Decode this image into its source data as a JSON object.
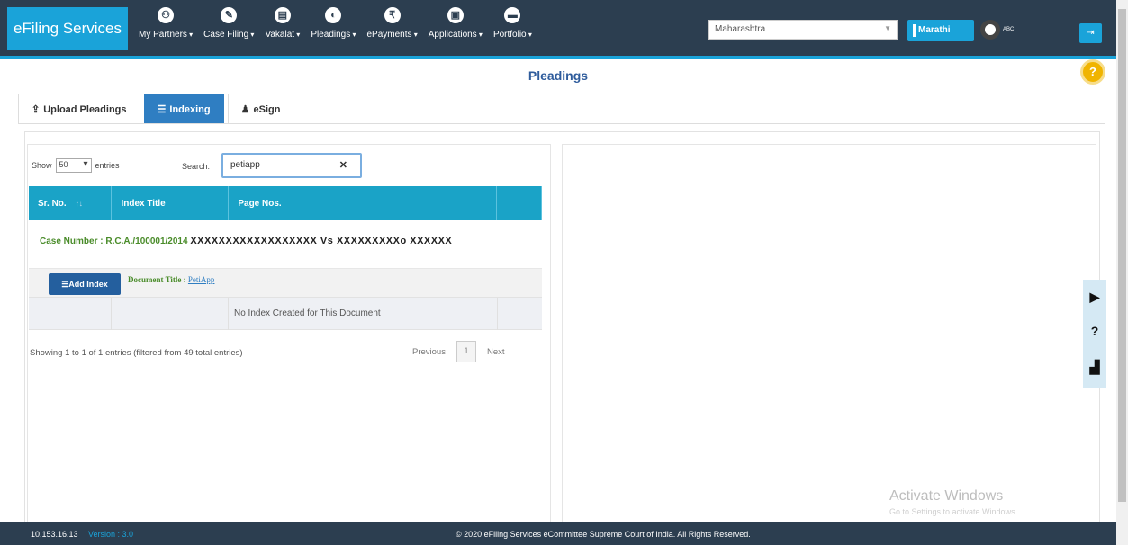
{
  "header": {
    "brand": "eFiling Services",
    "nav": [
      {
        "label": "My Partners",
        "icon": "partners-icon",
        "glyph": "⚇"
      },
      {
        "label": "Case Filing",
        "icon": "pencil-icon",
        "glyph": "✎"
      },
      {
        "label": "Vakalat",
        "icon": "document-icon",
        "glyph": "▤"
      },
      {
        "label": "Pleadings",
        "icon": "pleadings-icon",
        "glyph": "◐"
      },
      {
        "label": "ePayments",
        "icon": "rupee-icon",
        "glyph": "₹"
      },
      {
        "label": "Applications",
        "icon": "application-icon",
        "glyph": "▣"
      },
      {
        "label": "Portfolio",
        "icon": "briefcase-icon",
        "glyph": "▬"
      }
    ],
    "state_select": "Maharashtra",
    "language_button": "Marathi",
    "font_toggle_label": "ABC"
  },
  "page_title": "Pleadings",
  "tabs": [
    {
      "label": "Upload Pleadings",
      "icon": "upload-icon",
      "glyph": "⇪",
      "active": false
    },
    {
      "label": "Indexing",
      "icon": "list-icon",
      "glyph": "☰",
      "active": true
    },
    {
      "label": "eSign",
      "icon": "user-sign-icon",
      "glyph": "♟",
      "active": false
    }
  ],
  "table_controls": {
    "show_label": "Show",
    "entries_value": "50",
    "entries_label": "entries",
    "search_label": "Search:",
    "search_value": "petiapp"
  },
  "table": {
    "columns": [
      "Sr. No.",
      "Index Title",
      "Page Nos.",
      ""
    ],
    "case_label": "Case Number : ",
    "case_number": "R.C.A./100001/2014",
    "parties": "XXXXXXXXXXXXXXXXXX Vs XXXXXXXXXo XXXXXX",
    "add_index_label": "Add Index",
    "document_title_label": "Document Title : ",
    "document_title": "PetiApp",
    "empty_message": "No Index Created for This Document"
  },
  "pagination": {
    "info": "Showing 1 to 1 of 1 entries (filtered from 49 total entries)",
    "previous": "Previous",
    "page": "1",
    "next": "Next"
  },
  "watermark": {
    "line1": "Activate Windows",
    "line2": "Go to Settings to activate Windows."
  },
  "footer": {
    "ip": "10.153.16.13",
    "version": "Version : 3.0",
    "copyright": "© 2020 eFiling Services eCommittee Supreme Court of India. All Rights Reserved."
  },
  "colors": {
    "header_bg": "#2c3e50",
    "accent": "#1aa3d9",
    "active_tab": "#2f7ec2",
    "table_header": "#1aa3c7",
    "case_green": "#4a8c2a"
  }
}
